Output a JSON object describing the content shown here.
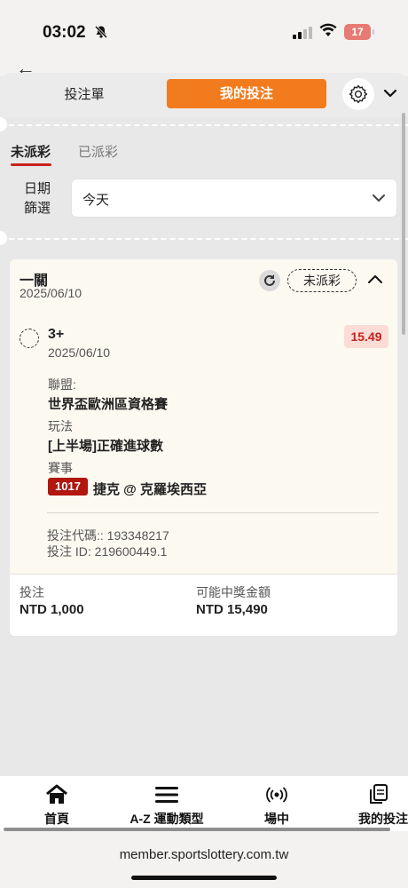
{
  "status_bar": {
    "time": "03:02",
    "battery": "17"
  },
  "header": {
    "tab_betslip": "投注單",
    "tab_my_bets": "我的投注"
  },
  "subtabs": {
    "unsettled": "未派彩",
    "settled": "已派彩"
  },
  "date_filter": {
    "label_line1": "日期",
    "label_line2": "篩選",
    "value": "今天"
  },
  "bet": {
    "type": "一關",
    "date": "2025/06/10",
    "status": "未派彩",
    "selection": "3+",
    "selection_date": "2025/06/10",
    "odds": "15.49",
    "league_label": "聯盟:",
    "league": "世界盃歐洲區資格賽",
    "market_label": "玩法",
    "market": "[上半場]正確進球數",
    "event_label": "賽事",
    "match_no": "1017",
    "match": "捷克 @ 克羅埃西亞",
    "bet_code": "投注代碼:: 193348217",
    "bet_id": "投注 ID: 219600449.1",
    "stake_label": "投注",
    "stake": "NTD 1,000",
    "payout_label": "可能中獎金額",
    "payout": "NTD 15,490"
  },
  "bottom_nav": [
    {
      "label": "首頁",
      "icon": "home-icon"
    },
    {
      "label": "A-Z 運動類型",
      "icon": "menu-icon"
    },
    {
      "label": "場中",
      "icon": "live-icon"
    },
    {
      "label": "我的投注",
      "icon": "copy-icon"
    }
  ],
  "browser": {
    "url": "member.sportslottery.com.tw"
  },
  "colors": {
    "accent": "#f27b1d",
    "red": "#c8221d",
    "badge": "#b1160f",
    "card": "#fcf9f1"
  }
}
